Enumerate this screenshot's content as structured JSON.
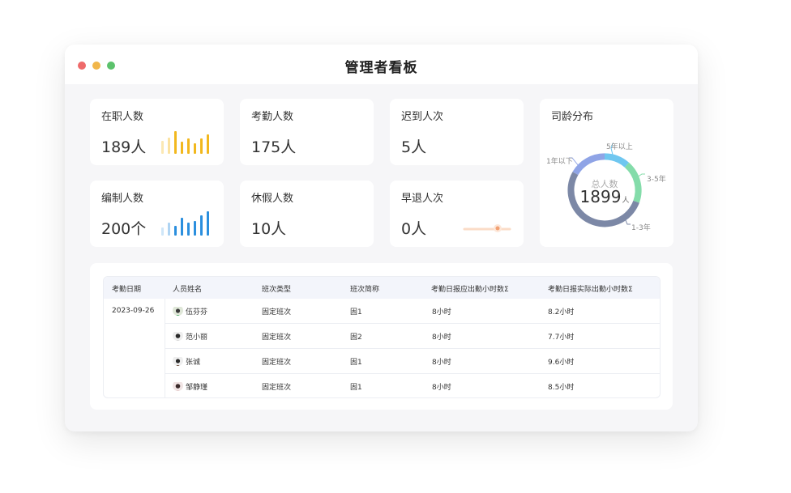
{
  "window": {
    "title": "管理者看板"
  },
  "stats": {
    "active": {
      "label": "在职人数",
      "value": "189人"
    },
    "attend": {
      "label": "考勤人数",
      "value": "175人"
    },
    "late": {
      "label": "迟到人次",
      "value": "5人"
    },
    "staffing": {
      "label": "编制人数",
      "value": "200个"
    },
    "leave": {
      "label": "休假人数",
      "value": "10人"
    },
    "early": {
      "label": "早退人次",
      "value": "0人"
    }
  },
  "tenure": {
    "title": "司龄分布",
    "center_label": "总人数",
    "total": "1899",
    "unit": "人",
    "segments": [
      {
        "label": "1年以下",
        "color": "#8fa4e6"
      },
      {
        "label": "5年以上",
        "color": "#6fc7f0"
      },
      {
        "label": "3-5年",
        "color": "#84dcaa"
      },
      {
        "label": "1-3年",
        "color": "#7c88a6"
      }
    ]
  },
  "table": {
    "headers": [
      "考勤日期",
      "人员姓名",
      "班次类型",
      "班次简称",
      "考勤日报应出勤小时数Σ",
      "考勤日报实际出勤小时数Σ"
    ],
    "date": "2023-09-26",
    "rows": [
      {
        "name": "伍芬芬",
        "type": "固定班次",
        "short": "固1",
        "expected": "8小时",
        "actual": "8.2小时"
      },
      {
        "name": "范小丽",
        "type": "固定班次",
        "short": "固2",
        "expected": "8小时",
        "actual": "7.7小时"
      },
      {
        "name": "张诚",
        "type": "固定班次",
        "short": "固1",
        "expected": "8小时",
        "actual": "9.6小时"
      },
      {
        "name": "邹静瑾",
        "type": "固定班次",
        "short": "固1",
        "expected": "8小时",
        "actual": "8.5小时"
      }
    ]
  },
  "colors": {
    "accent_yellow": "#f2b81e",
    "accent_blue": "#2b8fde",
    "accent_orange": "#f2a072"
  }
}
